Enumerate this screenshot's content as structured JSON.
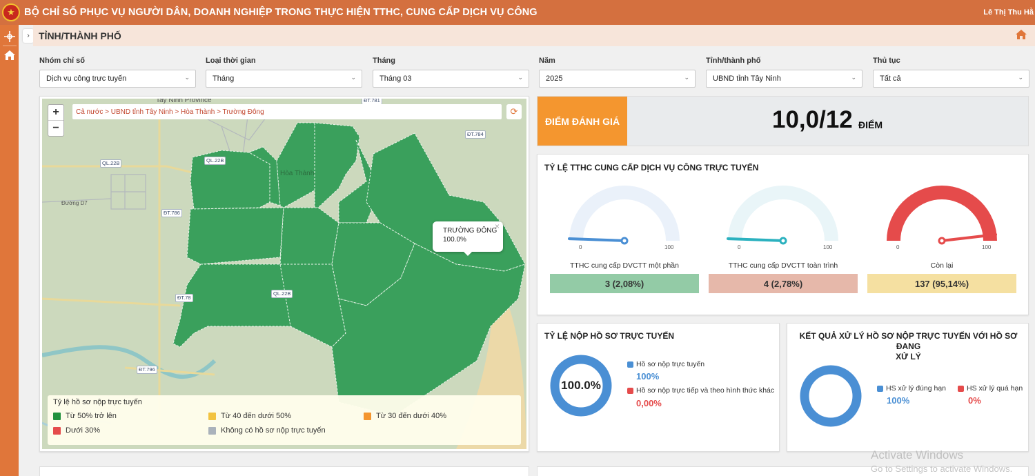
{
  "header": {
    "app_title": "BỘ CHỈ SỐ PHỤC VỤ NGƯỜI DÂN, DOANH NGHIỆP TRONG THỰC HIỆN TTHC, CUNG CẤP DỊCH VỤ CÔNG",
    "user_name": "Lê Thị Thu Hằ"
  },
  "page": {
    "title": "TỈNH/THÀNH PHỐ"
  },
  "filters": [
    {
      "label": "Nhóm chỉ số",
      "value": "Dịch vụ công trực tuyến"
    },
    {
      "label": "Loại thời gian",
      "value": "Tháng"
    },
    {
      "label": "Tháng",
      "value": "Tháng 03"
    },
    {
      "label": "Năm",
      "value": "2025"
    },
    {
      "label": "Tỉnh/thành phố",
      "value": "UBND tỉnh Tây Ninh"
    },
    {
      "label": "Thủ tục",
      "value": "Tất cả"
    }
  ],
  "map": {
    "breadcrumb": "Cả nước > UBND tỉnh Tây Ninh > Hòa Thành > Trường Đông",
    "zoom_in": "+",
    "zoom_out": "−",
    "place_labels": {
      "province": "Tay Ninh Province",
      "district": "Hòa Thành",
      "road": "Đường D7"
    },
    "road_badges": [
      "ĐT.781",
      "ĐT.784",
      "QL.22B",
      "QL.22B",
      "ĐT.786",
      "ĐT.78",
      "QL.22B",
      "ĐT.796"
    ],
    "popup": {
      "name": "TRƯỜNG ĐÔNG",
      "value": "100.0%",
      "close": "×"
    },
    "legend": {
      "title": "Tỷ lệ hồ sơ nộp trực tuyến",
      "items": [
        {
          "label": "Từ 50% trở lên",
          "color": "#21913d"
        },
        {
          "label": "Từ 40 đến dưới 50%",
          "color": "#f2c341"
        },
        {
          "label": "Từ 30 đến dưới 40%",
          "color": "#f4962f"
        },
        {
          "label": "Dưới 30%",
          "color": "#e54b4b"
        },
        {
          "label": "Không có hồ sơ nộp trực tuyến",
          "color": "#aab2bb"
        }
      ]
    }
  },
  "score": {
    "label": "ĐIỂM ĐÁNH GIÁ",
    "value": "10,0/12",
    "unit": "ĐIỂM"
  },
  "rate_card": {
    "title": "TỶ LỆ TTHC CUNG CẤP DỊCH VỤ CÔNG TRỰC TUYẾN",
    "gauges": [
      {
        "caption": "TTHC cung cấp DVCTT một phần",
        "value_text": "3 (2,08%)",
        "percent": 2.08,
        "min": "0",
        "max": "100",
        "color": "#4a8fd4",
        "track": "#eaf1fa",
        "box": "#93cba6"
      },
      {
        "caption": "TTHC cung cấp DVCTT toàn trình",
        "value_text": "4 (2,78%)",
        "percent": 2.78,
        "min": "0",
        "max": "100",
        "color": "#2bb1bf",
        "track": "#e9f5f8",
        "box": "#e6b8aa"
      },
      {
        "caption": "Còn lại",
        "value_text": "137 (95,14%)",
        "percent": 95.14,
        "min": "0",
        "max": "100",
        "color": "#e54b4b",
        "track": "#fde8e8",
        "box": "#f5e0a1"
      }
    ]
  },
  "online_card": {
    "title": "TỶ LỆ NỘP HỒ SƠ TRỰC TUYẾN",
    "center_text": "100.0%",
    "items": [
      {
        "label": "Hồ sơ nộp trực tuyến",
        "value": "100%",
        "color": "#4a8fd4"
      },
      {
        "label": "Hồ sơ nộp trực tiếp và theo hình thức khác",
        "value": "0,00%",
        "color": "#e54b4b"
      }
    ]
  },
  "result_card": {
    "title_line1": "KẾT QUẢ XỬ LÝ HỒ SƠ NỘP TRỰC TUYẾN VỚI HỒ SƠ ĐANG",
    "title_line2": "XỬ LÝ",
    "items": [
      {
        "label": "HS xử lý đúng hạn",
        "value": "100%",
        "color": "#4a8fd4"
      },
      {
        "label": "HS xử lý quá hạn",
        "value": "0%",
        "color": "#e54b4b"
      }
    ]
  },
  "watermark": {
    "line1": "Activate Windows",
    "line2": "Go to Settings to activate Windows."
  }
}
